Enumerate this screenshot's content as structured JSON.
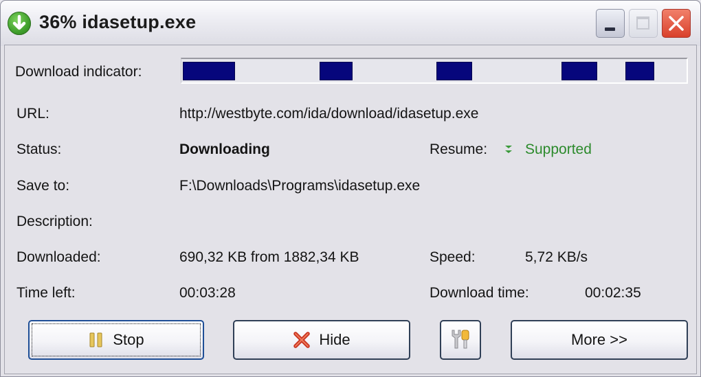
{
  "window": {
    "title": "36% idasetup.exe",
    "title_icon": "download-arrow-icon",
    "controls": [
      "minimize",
      "maximize",
      "close"
    ]
  },
  "download": {
    "indicator_label": "Download indicator:",
    "indicator_segments": 5,
    "fields": {
      "url": {
        "label": "URL:",
        "value": "http://westbyte.com/ida/download/idasetup.exe"
      },
      "status": {
        "label": "Status:",
        "value": "Downloading"
      },
      "resume": {
        "label": "Resume:",
        "value": "Supported",
        "icon": "double-chevron-down-icon",
        "color": "#2c8a2c"
      },
      "save_to": {
        "label": "Save to:",
        "value": "F:\\Downloads\\Programs\\idasetup.exe"
      },
      "description": {
        "label": "Description:",
        "value": ""
      },
      "downloaded": {
        "label": "Downloaded:",
        "value": "690,32 KB from 1882,34 KB"
      },
      "speed": {
        "label": "Speed:",
        "value": "5,72 KB/s"
      },
      "time_left": {
        "label": "Time left:",
        "value": "00:03:28"
      },
      "download_time": {
        "label": "Download time:",
        "value": "00:02:35"
      }
    },
    "progress_percent": 36
  },
  "buttons": {
    "stop": {
      "label": "Stop",
      "icon": "pause-icon"
    },
    "hide": {
      "label": "Hide",
      "icon": "red-x-icon"
    },
    "tools": {
      "label": "",
      "icon": "tools-icon"
    },
    "more": {
      "label": "More >>"
    }
  },
  "colors": {
    "indicator_fill": "#06067c",
    "status_green": "#2c8a2c",
    "close_red": "#d9412c"
  }
}
